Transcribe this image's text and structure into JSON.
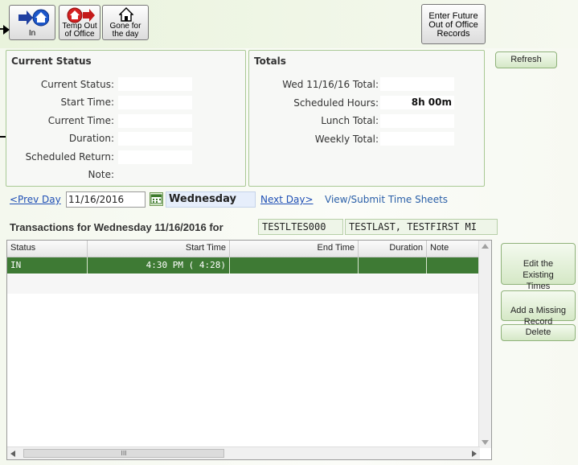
{
  "toolbar": {
    "in_label": "In",
    "temp_out_label": "Temp Out\nof Office",
    "gone_label": "Gone for\nthe day",
    "future_label": "Enter Future\nOut of Office\nRecords"
  },
  "current_status": {
    "title": "Current Status",
    "current_status_label": "Current Status:",
    "start_time_label": "Start Time:",
    "current_time_label": "Current Time:",
    "duration_label": "Duration:",
    "scheduled_return_label": "Scheduled Return:",
    "note_label": "Note:"
  },
  "totals": {
    "title": "Totals",
    "day_total_label": "Wed 11/16/16 Total:",
    "scheduled_hours_label": "Scheduled Hours:",
    "scheduled_hours_value": "8h 00m",
    "lunch_total_label": "Lunch Total:",
    "weekly_total_label": "Weekly Total:"
  },
  "refresh_label": "Refresh",
  "nav": {
    "prev_day": "<Prev Day",
    "date_value": "11/16/2016",
    "weekday": "Wednesday",
    "next_day": "Next Day>",
    "view_submit": "View/Submit Time Sheets"
  },
  "transactions": {
    "title": "Transactions for Wednesday 11/16/2016 for",
    "employee_id": "TESTLTES000",
    "employee_name": "TESTLAST, TESTFIRST MI"
  },
  "grid": {
    "columns": [
      "Status",
      "Start Time",
      "End Time",
      "Duration",
      "Note"
    ],
    "rows": [
      {
        "status": "IN",
        "start": "4:30 PM ( 4:28)",
        "end": "",
        "duration": "",
        "note": ""
      }
    ]
  },
  "side_buttons": {
    "edit": "Edit the\nExisting\nTimes",
    "add": "Add a Missing\nRecord",
    "delete": "Delete"
  },
  "scroll": {
    "h_thumb_glyph": "III"
  },
  "colors": {
    "selected_row": "#3e7a34",
    "panel_border": "#a9c994",
    "link": "#1f4fb5"
  }
}
